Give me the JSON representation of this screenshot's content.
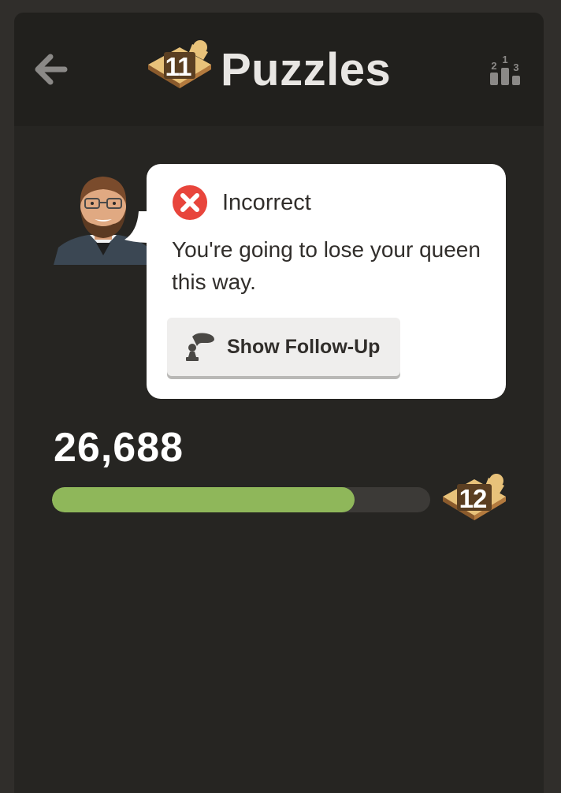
{
  "header": {
    "title": "Puzzles",
    "level_badge": "11",
    "back_icon": "arrow-left-icon",
    "leaderboard_icon": "podium-icon",
    "leaderboard_ranks": [
      "1",
      "2",
      "3"
    ]
  },
  "feedback": {
    "status": "Incorrect",
    "status_icon": "x-circle-icon",
    "message": "You're going to lose your queen this way.",
    "follow_up_label": "Show Follow-Up",
    "follow_up_icon": "chess-pawn-hint-icon"
  },
  "progress": {
    "rating": "26,688",
    "fraction": 0.8,
    "next_level_badge": "12"
  },
  "colors": {
    "background": "#262522",
    "header": "#21201d",
    "accent_green": "#8fb75a",
    "error_red": "#e8453c",
    "bubble": "#ffffff"
  }
}
